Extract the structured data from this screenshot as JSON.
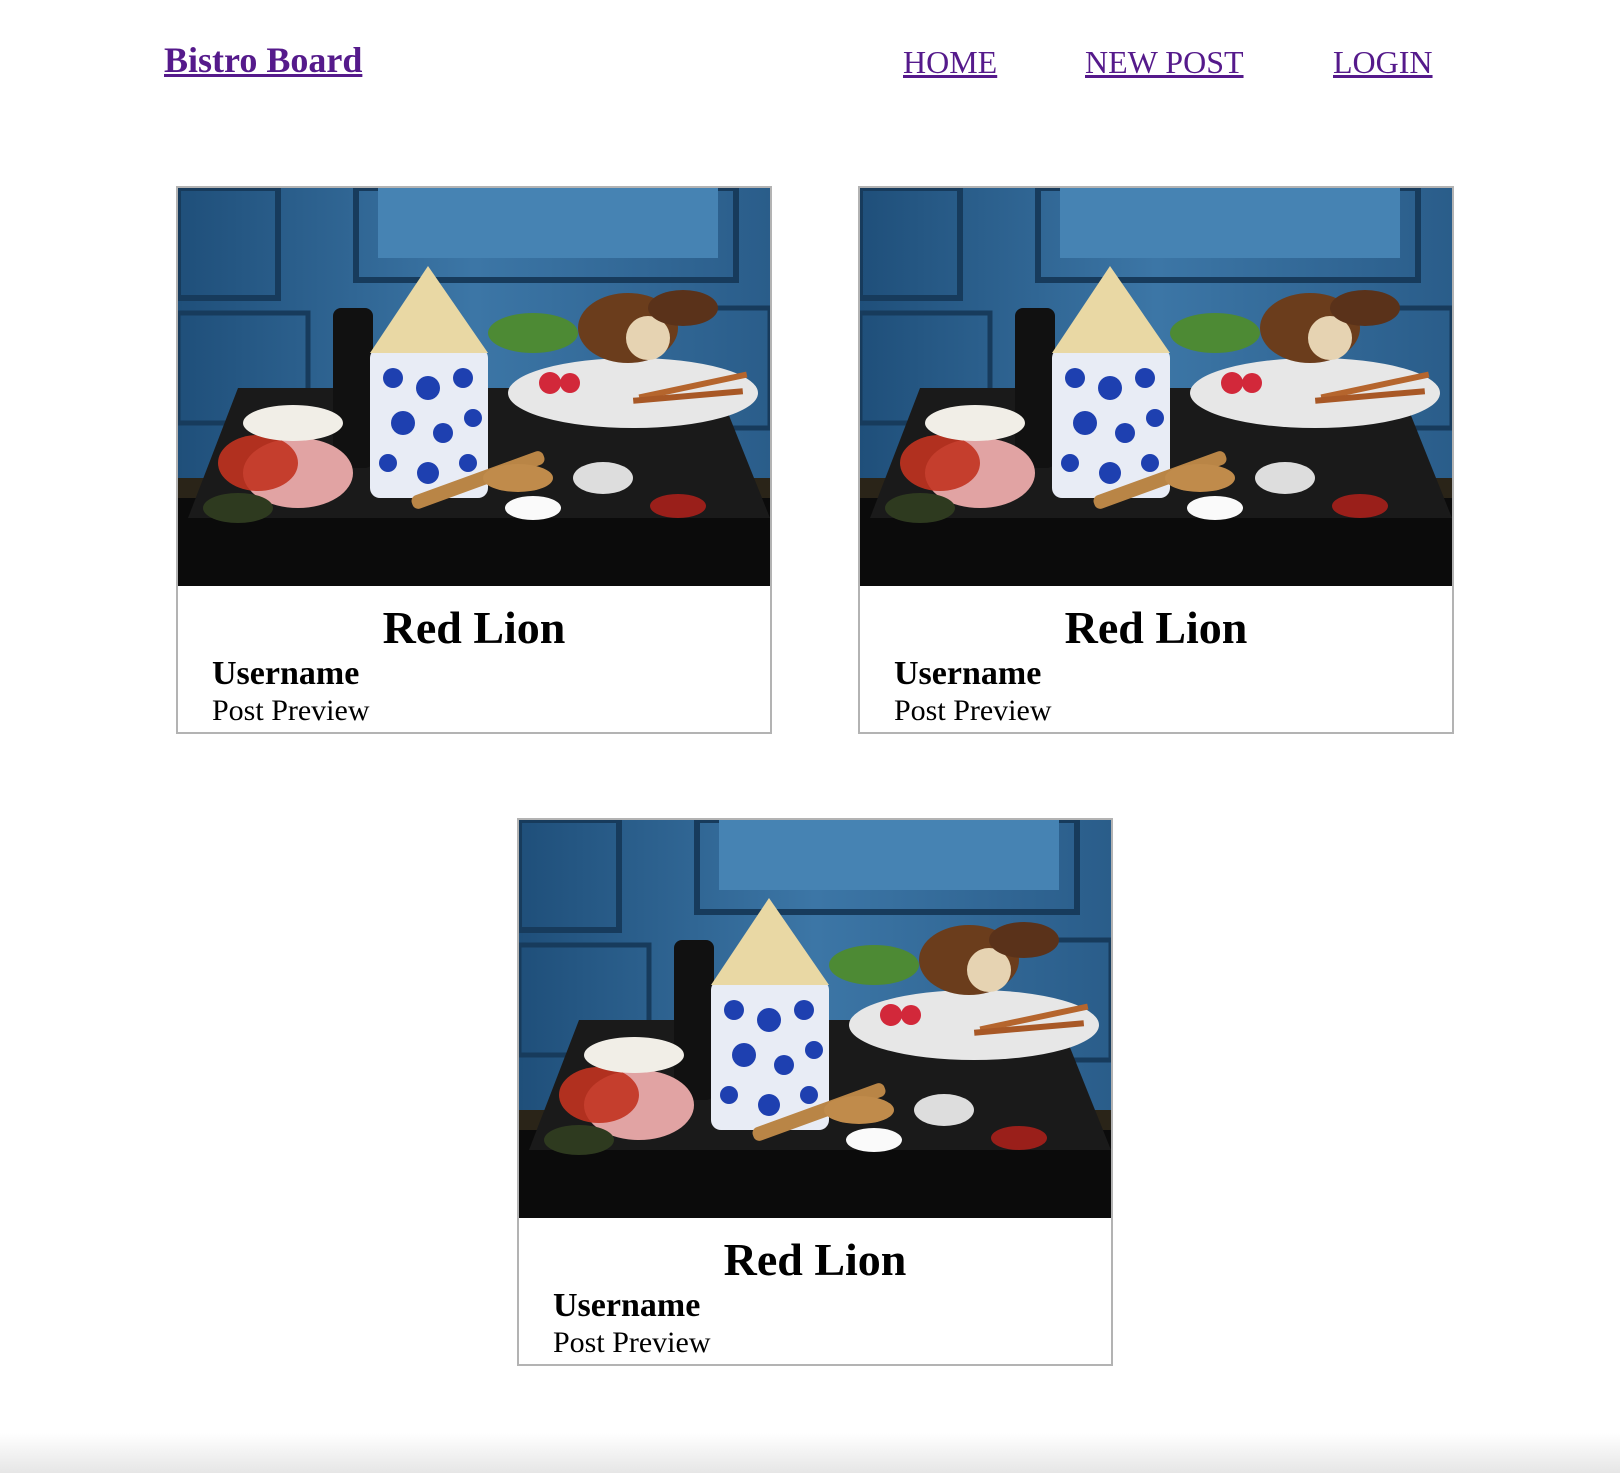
{
  "header": {
    "brand": "Bistro Board",
    "nav": {
      "home": "HOME",
      "new_post": "NEW POST",
      "login": "LOGIN"
    }
  },
  "colors": {
    "link": "#551a8b",
    "card_border": "#b3b3b3"
  },
  "posts": [
    {
      "title": "Red Lion",
      "username": "Username",
      "preview": "Post Preview"
    },
    {
      "title": "Red Lion",
      "username": "Username",
      "preview": "Post Preview"
    },
    {
      "title": "Red Lion",
      "username": "Username",
      "preview": "Post Preview"
    }
  ]
}
